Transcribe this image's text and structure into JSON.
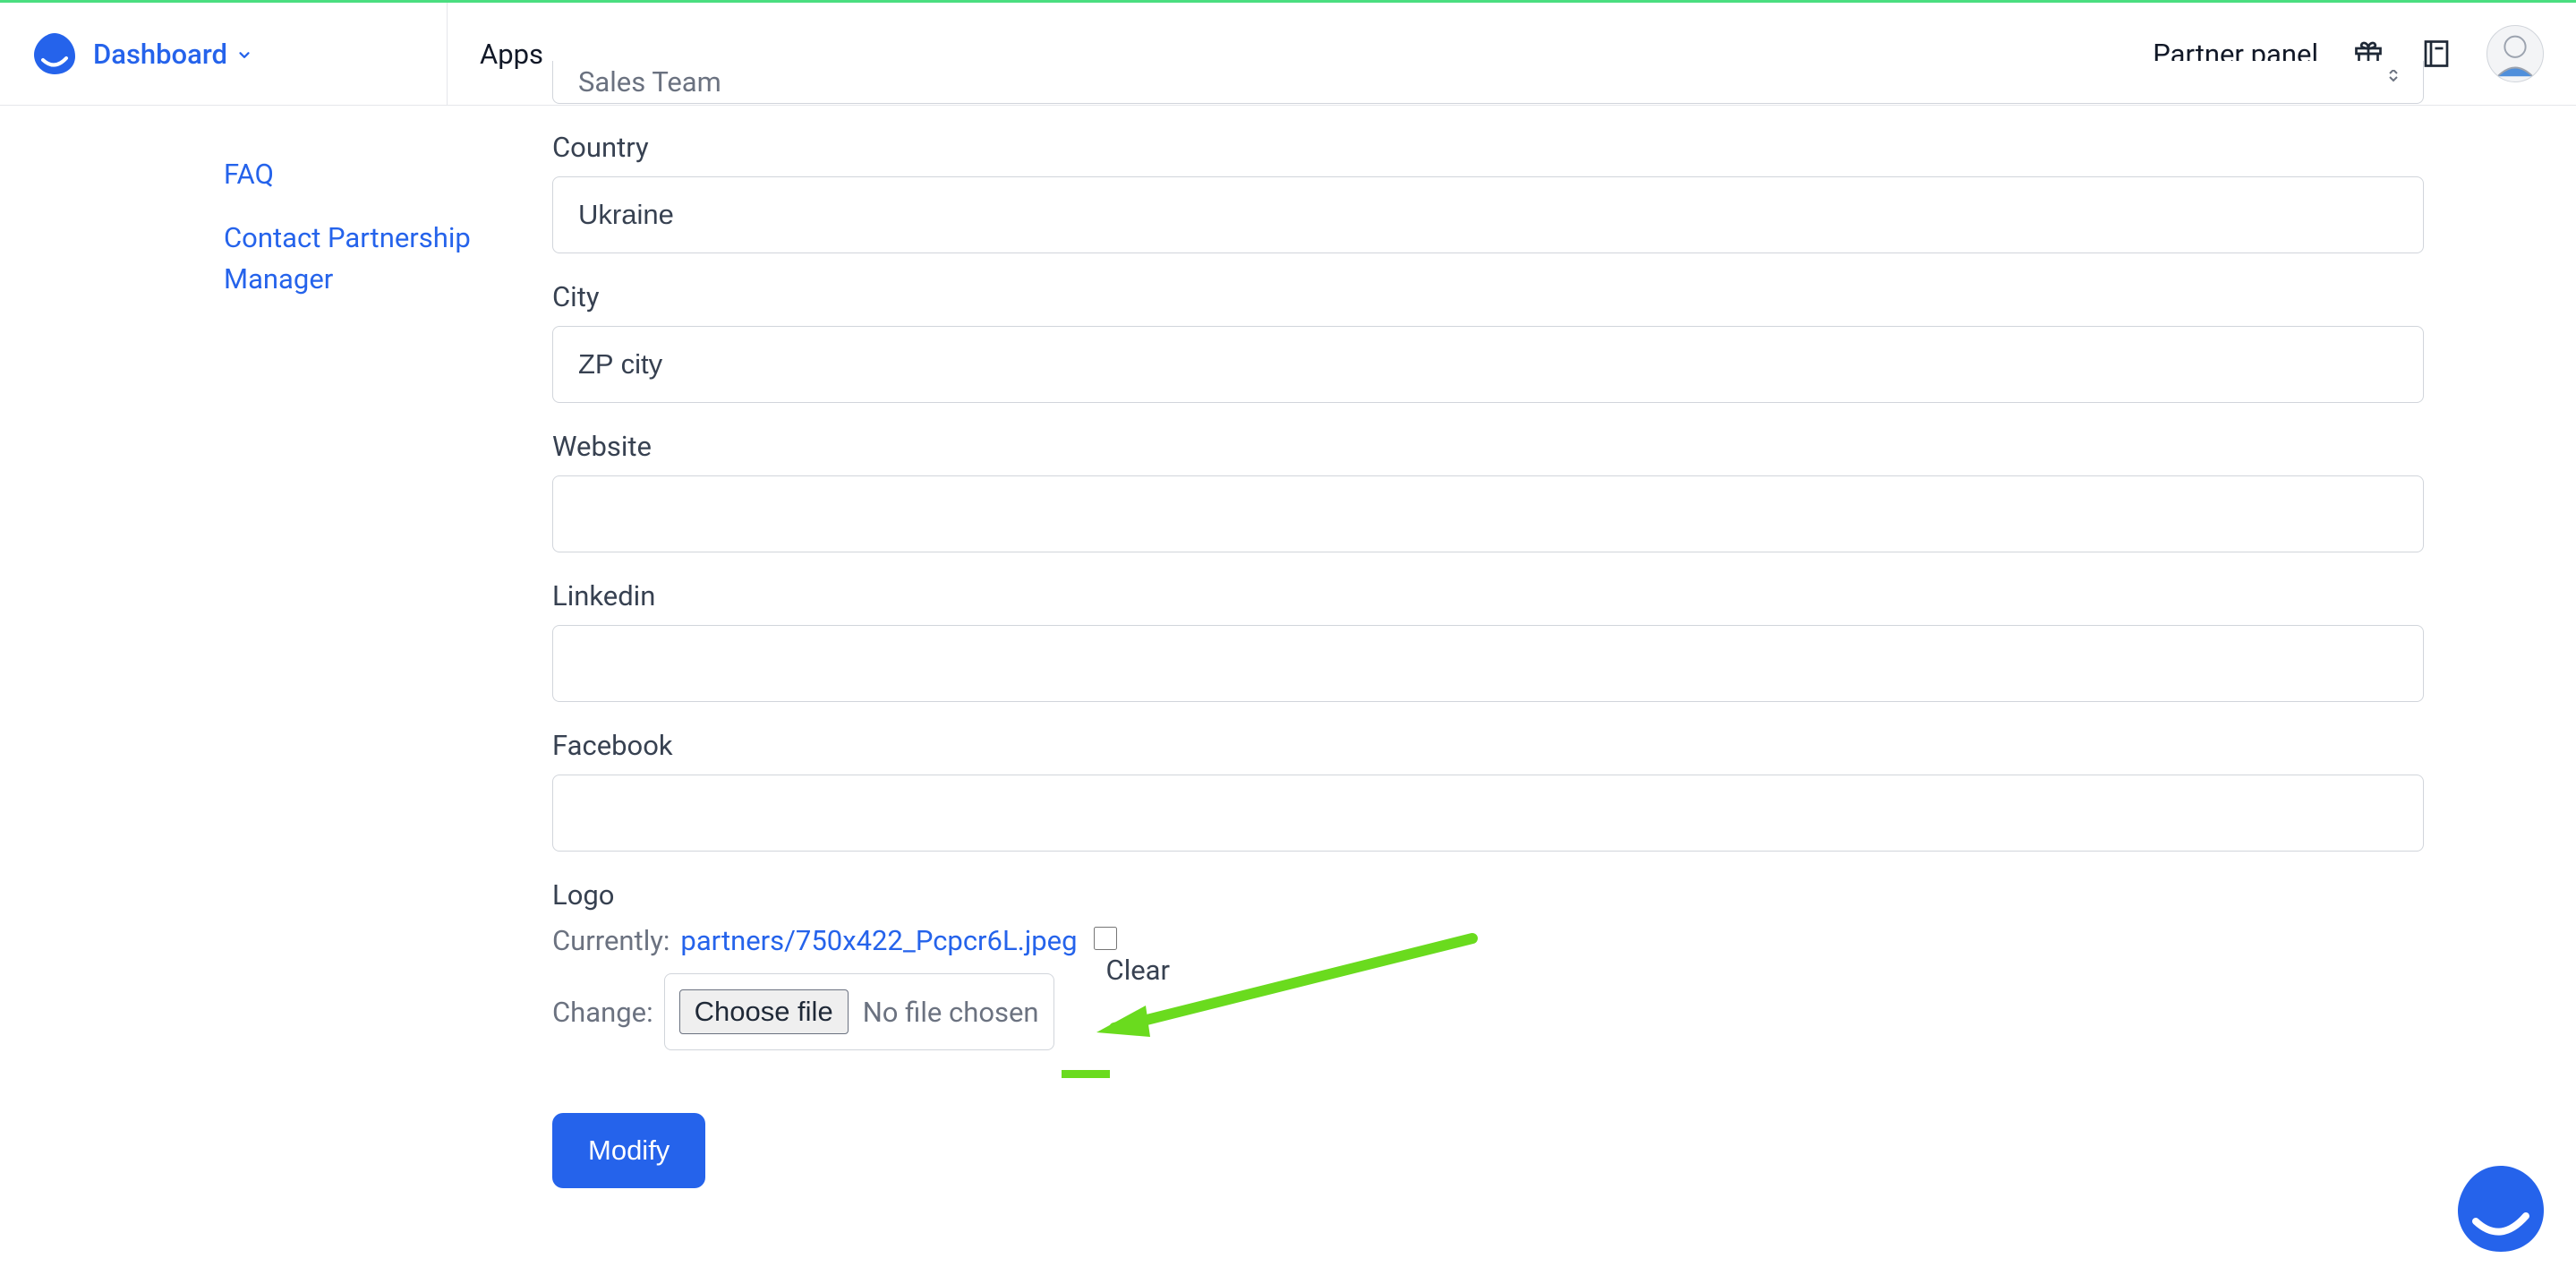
{
  "header": {
    "dashboard_label": "Dashboard",
    "apps_label": "Apps",
    "partner_panel_label": "Partner panel"
  },
  "sidebar": {
    "items": [
      {
        "label": "FAQ"
      },
      {
        "label": "Contact Partnership Manager"
      }
    ]
  },
  "form": {
    "sales_team": {
      "value": "Sales Team"
    },
    "country": {
      "label": "Country",
      "value": "Ukraine"
    },
    "city": {
      "label": "City",
      "value": "ZP city"
    },
    "website": {
      "label": "Website",
      "value": ""
    },
    "linkedin": {
      "label": "Linkedin",
      "value": ""
    },
    "facebook": {
      "label": "Facebook",
      "value": ""
    },
    "logo": {
      "label": "Logo",
      "currently_label": "Currently:",
      "file_name": "partners/750x422_Pcpcr6L.jpeg",
      "clear_label": "Clear",
      "change_label": "Change:",
      "choose_file_label": "Choose file",
      "no_file_text": "No file chosen"
    },
    "submit_label": "Modify"
  }
}
